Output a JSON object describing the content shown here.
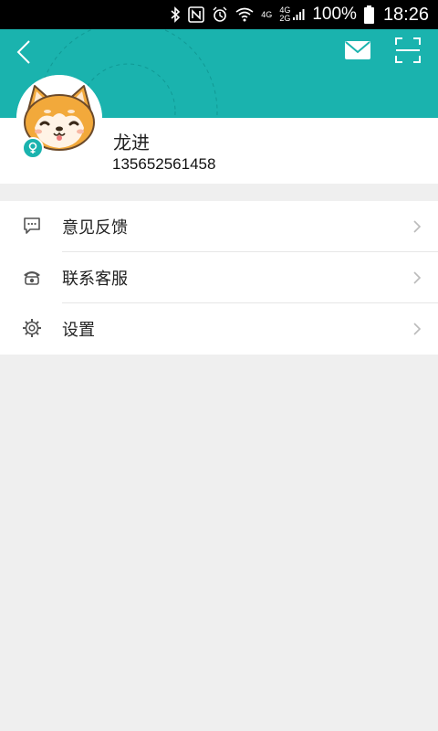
{
  "status_bar": {
    "network_label_top": "4G",
    "network_label_mid": "4G",
    "network_label_bottom": "2G",
    "battery": "100%",
    "time": "18:26"
  },
  "profile": {
    "name": "龙进",
    "phone": "135652561458",
    "gender_icon": "female-icon"
  },
  "menu": [
    {
      "label": "意见反馈",
      "icon": "feedback-icon"
    },
    {
      "label": "联系客服",
      "icon": "phone-icon"
    },
    {
      "label": "设置",
      "icon": "settings-icon"
    }
  ],
  "colors": {
    "header": "#1ab3ae",
    "background": "#efefef"
  }
}
